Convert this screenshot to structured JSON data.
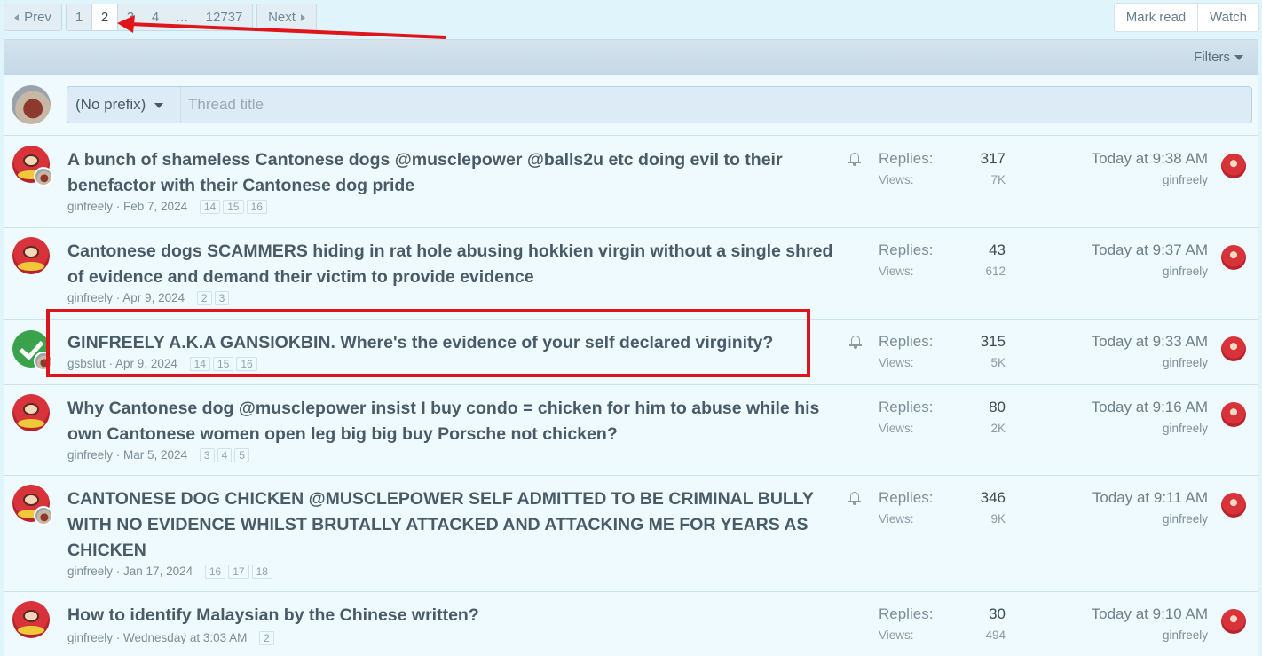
{
  "pagination": {
    "prev_label": "Prev",
    "next_label": "Next",
    "pages": [
      "1",
      "2",
      "3",
      "4",
      "…",
      "12737"
    ],
    "current": "2"
  },
  "actions": {
    "mark_read": "Mark read",
    "watch": "Watch"
  },
  "filter_bar": {
    "filters_label": "Filters"
  },
  "quick_thread": {
    "prefix": "(No prefix)",
    "placeholder": "Thread title"
  },
  "labels": {
    "replies": "Replies:",
    "views": "Views:"
  },
  "threads": [
    {
      "title_line1": "A bunch of shameless Cantonese dogs @musclepower @balls2u etc doing evil to their",
      "title_line2": "benefactor with their Cantonese dog pride",
      "title_line3": "",
      "author": "ginfreely",
      "date": "Feb 7, 2024",
      "pages": [
        "14",
        "15",
        "16"
      ],
      "replies": "317",
      "views": "7K",
      "last_date": "Today at 9:38 AM",
      "last_user": "ginfreely",
      "watched": true
    },
    {
      "title_line1": "Cantonese dogs SCAMMERS hiding in rat hole abusing hokkien virgin without a single shred",
      "title_line2": "of evidence and demand their victim to provide evidence",
      "title_line3": "",
      "author": "ginfreely",
      "date": "Apr 9, 2024",
      "pages": [
        "2",
        "3"
      ],
      "replies": "43",
      "views": "612",
      "last_date": "Today at 9:37 AM",
      "last_user": "ginfreely",
      "watched": false
    },
    {
      "title_line1": "GINFREELY A.K.A GANSIOKBIN. Where's the evidence of your self declared virginity?",
      "title_line2": "",
      "title_line3": "",
      "author": "gsbslut",
      "date": "Apr 9, 2024",
      "pages": [
        "14",
        "15",
        "16"
      ],
      "replies": "315",
      "views": "5K",
      "last_date": "Today at 9:33 AM",
      "last_user": "ginfreely",
      "watched": true
    },
    {
      "title_line1": "Why Cantonese dog @musclepower insist I buy condo = chicken for him to abuse while his",
      "title_line2": "own Cantonese women open leg big big buy Porsche not chicken?",
      "title_line3": "",
      "author": "ginfreely",
      "date": "Mar 5, 2024",
      "pages": [
        "3",
        "4",
        "5"
      ],
      "replies": "80",
      "views": "2K",
      "last_date": "Today at 9:16 AM",
      "last_user": "ginfreely",
      "watched": false
    },
    {
      "title_line1": "CANTONESE DOG CHICKEN @MUSCLEPOWER SELF ADMITTED TO BE CRIMINAL BULLY",
      "title_line2": "WITH NO EVIDENCE WHILST BRUTALLY ATTACKED AND ATTACKING ME FOR YEARS AS",
      "title_line3": "CHICKEN",
      "author": "ginfreely",
      "date": "Jan 17, 2024",
      "pages": [
        "16",
        "17",
        "18"
      ],
      "replies": "346",
      "views": "9K",
      "last_date": "Today at 9:11 AM",
      "last_user": "ginfreely",
      "watched": true
    },
    {
      "title_line1": "How to identify Malaysian by the Chinese written?",
      "title_line2": "",
      "title_line3": "",
      "author": "ginfreely",
      "date": "Wednesday at 3:03 AM",
      "pages": [
        "2"
      ],
      "replies": "30",
      "views": "494",
      "last_date": "Today at 9:10 AM",
      "last_user": "ginfreely",
      "watched": false
    }
  ],
  "colors": {
    "annotation": "#e0141b",
    "background": "#dff5fb",
    "title": "#4a5b68"
  }
}
